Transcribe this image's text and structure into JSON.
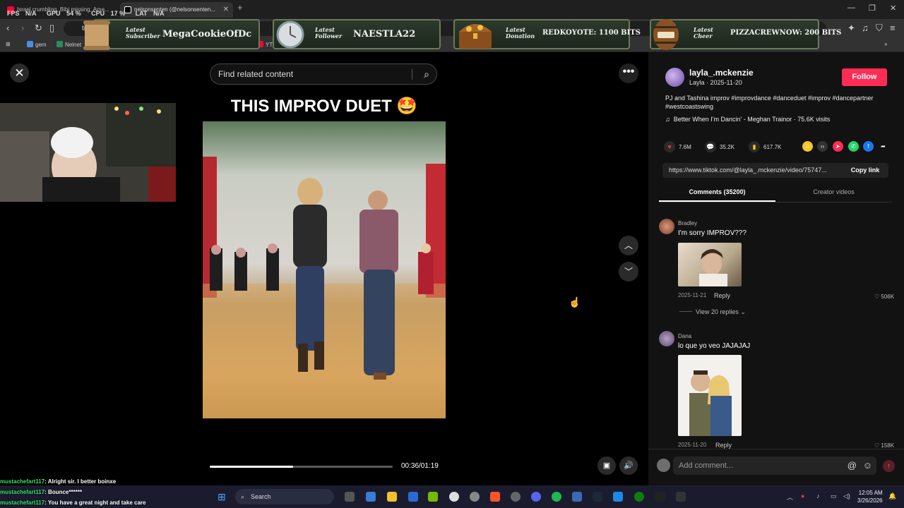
{
  "browser": {
    "tabs": [
      {
        "title": "Israel crumbling, Bibi missing, Ame...",
        "favicon_color": "#ff0033"
      },
      {
        "title": "nelsonsenten (@nelsonsenten...",
        "favicon_color": "#ffffff"
      }
    ],
    "url_fragment": "tiktok",
    "bookmarks": [
      "gem",
      "Nelnet",
      "YT St"
    ]
  },
  "perf": {
    "fps_label": "FPS",
    "fps": "N/A",
    "gpu_label": "GPU",
    "gpu": "54 %",
    "cpu_label": "CPU",
    "cpu": "17 %",
    "lat_label": "LAT",
    "lat": "N/A"
  },
  "overlay": [
    {
      "label_line1": "Latest",
      "label_line2": "Subscriber",
      "value": "MegaCookieOfDc"
    },
    {
      "label_line1": "Latest",
      "label_line2": "Follower",
      "value": "NAESTLA22"
    },
    {
      "label_line1": "Latest",
      "label_line2": "Donation",
      "value": "REDKOYOTE: 1100 BITS"
    },
    {
      "label_line1": "Latest",
      "label_line2": "Cheer",
      "value": "PIZZACREWNOW: 200 BITS"
    }
  ],
  "search": {
    "placeholder": "Find related content"
  },
  "video": {
    "title": "THIS IMPROV DUET 🤩",
    "time": "00:36/01:19",
    "progress_fraction": 0.456
  },
  "author": {
    "username": "layla_.mckenzie",
    "name_date": "Layla · 2025-11-20",
    "follow_label": "Follow",
    "caption": "PJ and Tashina improv #improvdance #danceduet #improv #dancepartner #westcoastswing",
    "music": "Better When I'm Dancin' - Meghan Trainor · 75.6K visits"
  },
  "stats": {
    "likes": "7.6M",
    "comments": "35.2K",
    "saves": "617.7K"
  },
  "link": {
    "url": "https://www.tiktok.com/@layla_.mckenzie/video/75747...",
    "copy_label": "Copy link"
  },
  "tabs": {
    "comments": "Comments (35200)",
    "creator": "Creator videos"
  },
  "comments": [
    {
      "user": "Bradley",
      "text": "I'm sorry IMPROV???",
      "date": "2025-11-21",
      "reply": "Reply",
      "likes": "506K",
      "replies": "View 20 replies"
    },
    {
      "user": "Dana",
      "text": "lo que yo veo JAJAJAJ",
      "date": "2025-11-20",
      "reply": "Reply",
      "likes": "158K"
    }
  ],
  "add_comment": {
    "placeholder": "Add comment..."
  },
  "chat": [
    {
      "user": "mustachefart117",
      "text": ": Alright sir. I better boinxe"
    },
    {
      "user": "mustachefart117",
      "text": ": Bounce******"
    },
    {
      "user": "mustachefart117",
      "text": ": You have a great night and take care"
    }
  ],
  "taskbar": {
    "search": "Search",
    "time": "12:05 AM",
    "date": "3/26/2026"
  },
  "colors": {
    "accent": "#fe2c55",
    "chat_user": "#34e36b"
  }
}
